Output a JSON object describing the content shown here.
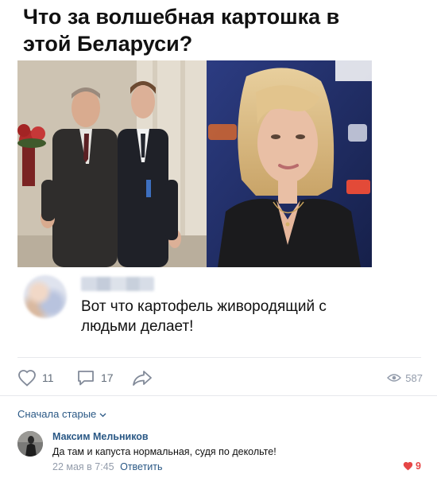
{
  "post": {
    "title": "Что за волшебная картошка в этой Беларуси?"
  },
  "meme": {
    "quote": "Вот что картофель живородящий с людьми делает!"
  },
  "actions": {
    "likes": "11",
    "comments": "17",
    "views": "587"
  },
  "comments_section": {
    "sort_label": "Сначала старые",
    "items": [
      {
        "author": "Максим Мельников",
        "text": "Да там и капуста нормальная, судя по декольте!",
        "time": "22 мая в 7:45",
        "reply_label": "Ответить",
        "likes": "9"
      }
    ]
  },
  "colors": {
    "link": "#2a5885",
    "muted": "#939cab",
    "like_red": "#e64646",
    "divider": "#e7e8ec"
  },
  "icons": [
    "heart-icon",
    "comment-icon",
    "share-icon",
    "eye-icon",
    "chevron-down-icon",
    "heart-filled-icon"
  ]
}
